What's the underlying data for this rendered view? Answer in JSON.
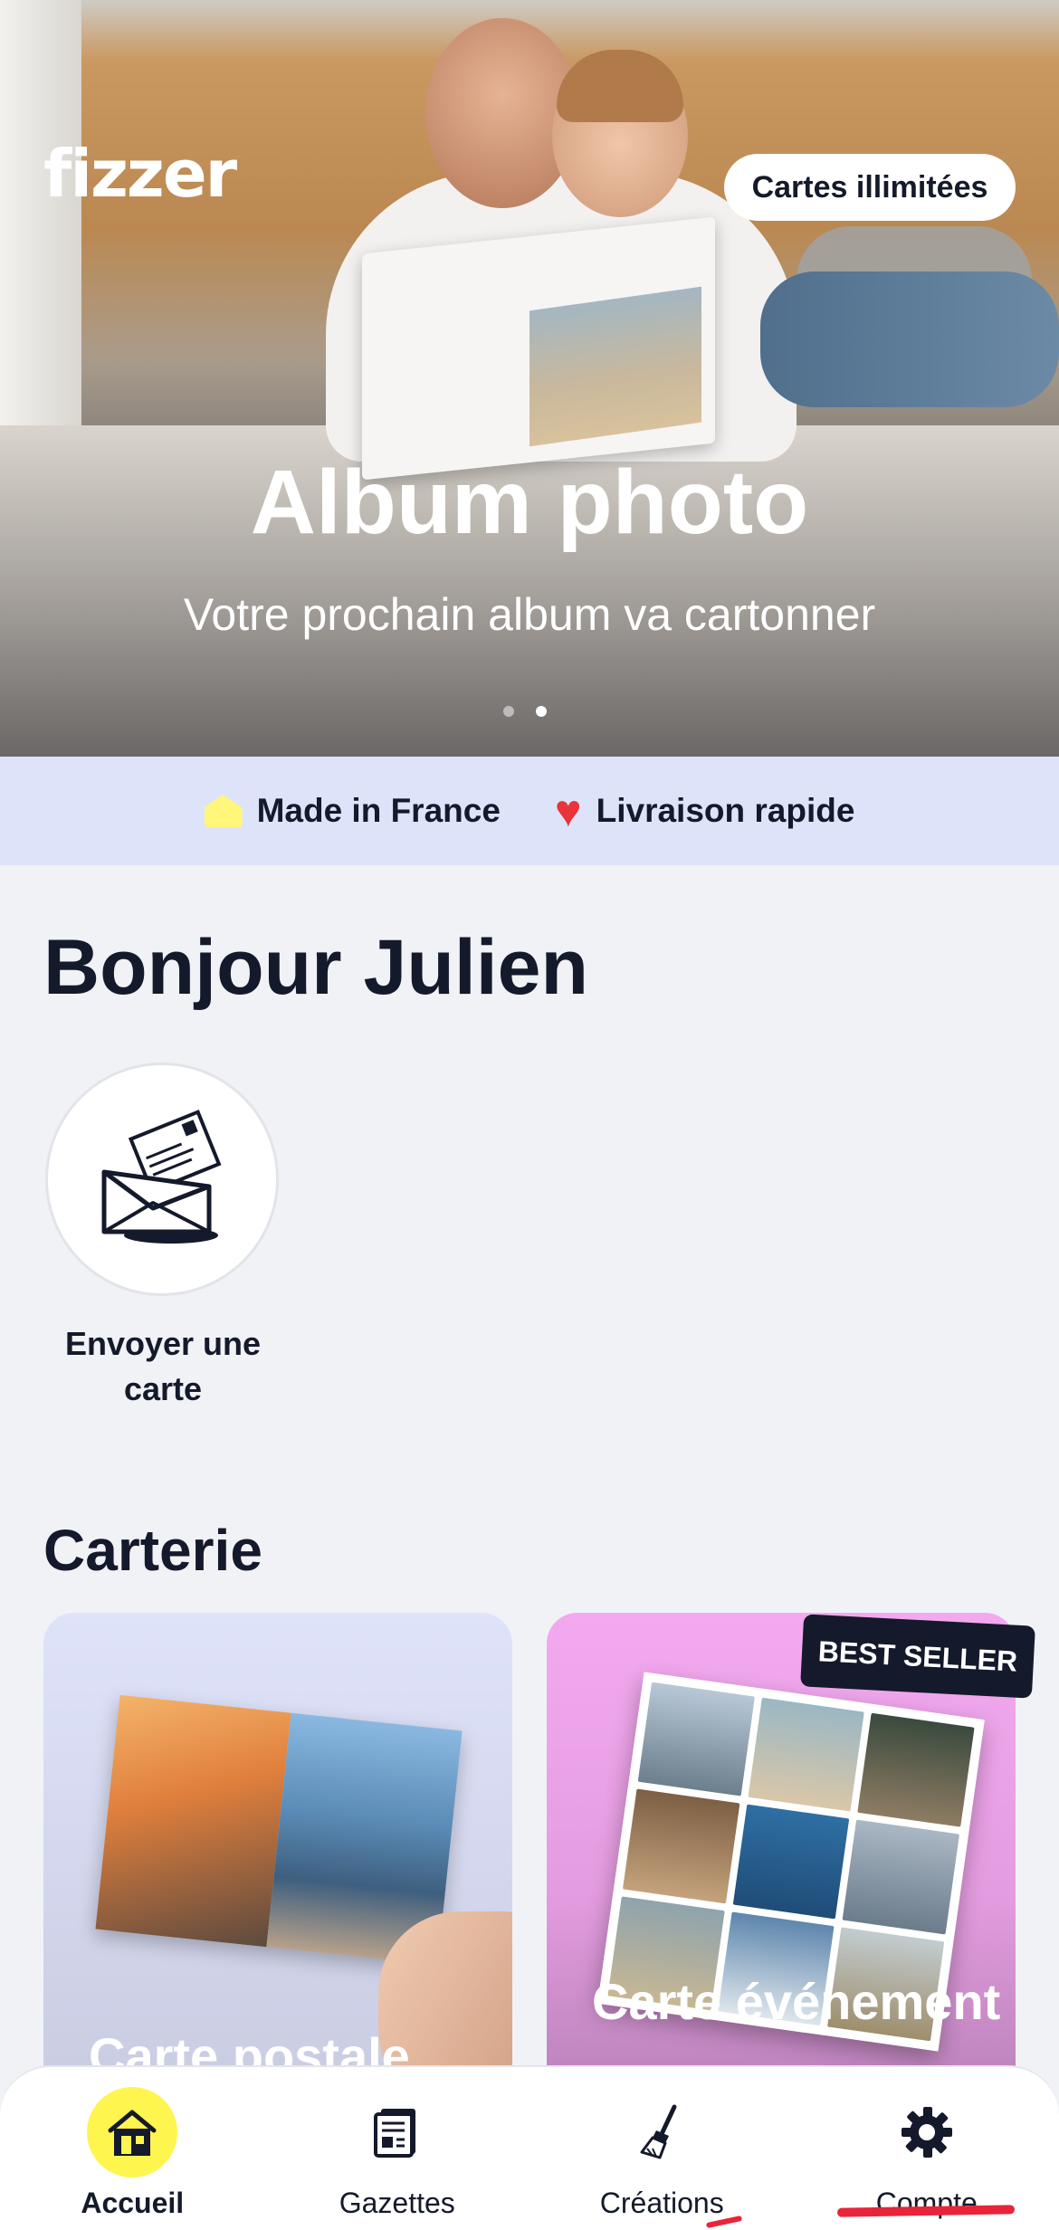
{
  "hero": {
    "logo": "fizzer",
    "cta": "Cartes illimitées",
    "title": "Album photo",
    "subtitle": "Votre prochain album va cartonner",
    "slides_total": 2,
    "active_slide": 2
  },
  "trust_bar": {
    "items": [
      {
        "icon": "home-icon",
        "label": "Made in France",
        "color": "#fff67a"
      },
      {
        "icon": "heart-icon",
        "label": "Livraison rapide",
        "color": "#e8343a"
      }
    ]
  },
  "greeting": "Bonjour Julien",
  "quick_actions": [
    {
      "icon": "envelope-icon",
      "label": "Envoyer une carte"
    }
  ],
  "carterie": {
    "title": "Carterie",
    "cards": [
      {
        "title": "Carte postale"
      },
      {
        "title": "Carte événement",
        "badge": "BEST SELLER"
      }
    ]
  },
  "bottom_nav": {
    "items": [
      {
        "icon": "house-icon",
        "label": "Accueil",
        "active": true
      },
      {
        "icon": "newspaper-icon",
        "label": "Gazettes",
        "active": false
      },
      {
        "icon": "brush-icon",
        "label": "Créations",
        "active": false
      },
      {
        "icon": "gear-icon",
        "label": "Compte",
        "active": false
      }
    ]
  },
  "colors": {
    "brand_dark": "#14192b",
    "nav_active": "#fff54f",
    "trust_bg": "#dde4fa",
    "annotation_red": "#e8243a"
  }
}
